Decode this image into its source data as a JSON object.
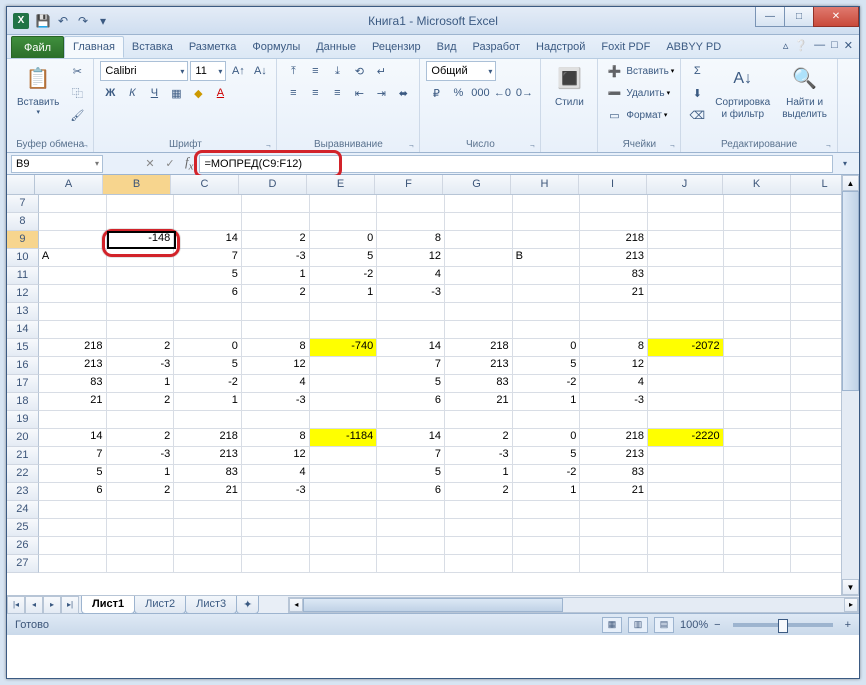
{
  "window": {
    "title": "Книга1 - Microsoft Excel"
  },
  "tabs": {
    "file": "Файл",
    "items": [
      "Главная",
      "Вставка",
      "Разметка",
      "Формулы",
      "Данные",
      "Рецензир",
      "Вид",
      "Разработ",
      "Надстрой",
      "Foxit PDF",
      "ABBYY PD"
    ],
    "active": 0
  },
  "ribbon": {
    "clipboard": {
      "paste": "Вставить",
      "label": "Буфер обмена"
    },
    "font": {
      "name": "Calibri",
      "size": "11",
      "label": "Шрифт"
    },
    "alignment": {
      "label": "Выравнивание"
    },
    "number": {
      "format": "Общий",
      "label": "Число"
    },
    "styles": {
      "label": "Стили",
      "btn": "Стили"
    },
    "cells": {
      "insert": "Вставить",
      "delete": "Удалить",
      "format": "Формат",
      "label": "Ячейки"
    },
    "editing": {
      "sort": "Сортировка\nи фильтр",
      "find": "Найти и\nвыделить",
      "label": "Редактирование"
    }
  },
  "namebox": "B9",
  "formula": "=МОПРЕД(C9:F12)",
  "columns": [
    "A",
    "B",
    "C",
    "D",
    "E",
    "F",
    "G",
    "H",
    "I",
    "J",
    "K",
    "L"
  ],
  "rows": [
    {
      "n": "7",
      "c": [
        "",
        "",
        "",
        "",
        "",
        "",
        "",
        "",
        "",
        "",
        "",
        ""
      ]
    },
    {
      "n": "8",
      "c": [
        "",
        "",
        "",
        "",
        "",
        "",
        "",
        "",
        "",
        "",
        "",
        ""
      ]
    },
    {
      "n": "9",
      "c": [
        "",
        "-148",
        "14",
        "2",
        "0",
        "8",
        "",
        "",
        "218",
        "",
        "",
        ""
      ],
      "sel": true
    },
    {
      "n": "10",
      "c": [
        "А",
        "",
        "7",
        "-3",
        "5",
        "12",
        "",
        "В",
        "213",
        "",
        "",
        ""
      ],
      "lt": [
        0,
        7
      ]
    },
    {
      "n": "11",
      "c": [
        "",
        "",
        "5",
        "1",
        "-2",
        "4",
        "",
        "",
        "83",
        "",
        "",
        ""
      ]
    },
    {
      "n": "12",
      "c": [
        "",
        "",
        "6",
        "2",
        "1",
        "-3",
        "",
        "",
        "21",
        "",
        "",
        ""
      ]
    },
    {
      "n": "13",
      "c": [
        "",
        "",
        "",
        "",
        "",
        "",
        "",
        "",
        "",
        "",
        "",
        ""
      ]
    },
    {
      "n": "14",
      "c": [
        "",
        "",
        "",
        "",
        "",
        "",
        "",
        "",
        "",
        "",
        "",
        ""
      ]
    },
    {
      "n": "15",
      "c": [
        "218",
        "2",
        "0",
        "8",
        "-740",
        "14",
        "218",
        "0",
        "8",
        "-2072",
        "",
        ""
      ],
      "yl": [
        4,
        9
      ]
    },
    {
      "n": "16",
      "c": [
        "213",
        "-3",
        "5",
        "12",
        "",
        "7",
        "213",
        "5",
        "12",
        "",
        "",
        ""
      ]
    },
    {
      "n": "17",
      "c": [
        "83",
        "1",
        "-2",
        "4",
        "",
        "5",
        "83",
        "-2",
        "4",
        "",
        "",
        ""
      ]
    },
    {
      "n": "18",
      "c": [
        "21",
        "2",
        "1",
        "-3",
        "",
        "6",
        "21",
        "1",
        "-3",
        "",
        "",
        ""
      ]
    },
    {
      "n": "19",
      "c": [
        "",
        "",
        "",
        "",
        "",
        "",
        "",
        "",
        "",
        "",
        "",
        ""
      ]
    },
    {
      "n": "20",
      "c": [
        "14",
        "2",
        "218",
        "8",
        "-1184",
        "14",
        "2",
        "0",
        "218",
        "-2220",
        "",
        ""
      ],
      "yl": [
        4,
        9
      ]
    },
    {
      "n": "21",
      "c": [
        "7",
        "-3",
        "213",
        "12",
        "",
        "7",
        "-3",
        "5",
        "213",
        "",
        "",
        ""
      ]
    },
    {
      "n": "22",
      "c": [
        "5",
        "1",
        "83",
        "4",
        "",
        "5",
        "1",
        "-2",
        "83",
        "",
        "",
        ""
      ]
    },
    {
      "n": "23",
      "c": [
        "6",
        "2",
        "21",
        "-3",
        "",
        "6",
        "2",
        "1",
        "21",
        "",
        "",
        ""
      ]
    },
    {
      "n": "24",
      "c": [
        "",
        "",
        "",
        "",
        "",
        "",
        "",
        "",
        "",
        "",
        "",
        ""
      ]
    },
    {
      "n": "25",
      "c": [
        "",
        "",
        "",
        "",
        "",
        "",
        "",
        "",
        "",
        "",
        "",
        ""
      ]
    },
    {
      "n": "26",
      "c": [
        "",
        "",
        "",
        "",
        "",
        "",
        "",
        "",
        "",
        "",
        "",
        ""
      ]
    },
    {
      "n": "27",
      "c": [
        "",
        "",
        "",
        "",
        "",
        "",
        "",
        "",
        "",
        "",
        "",
        ""
      ]
    }
  ],
  "sheets": {
    "items": [
      "Лист1",
      "Лист2",
      "Лист3"
    ],
    "active": 0
  },
  "status": {
    "ready": "Готово",
    "zoom": "100%"
  }
}
